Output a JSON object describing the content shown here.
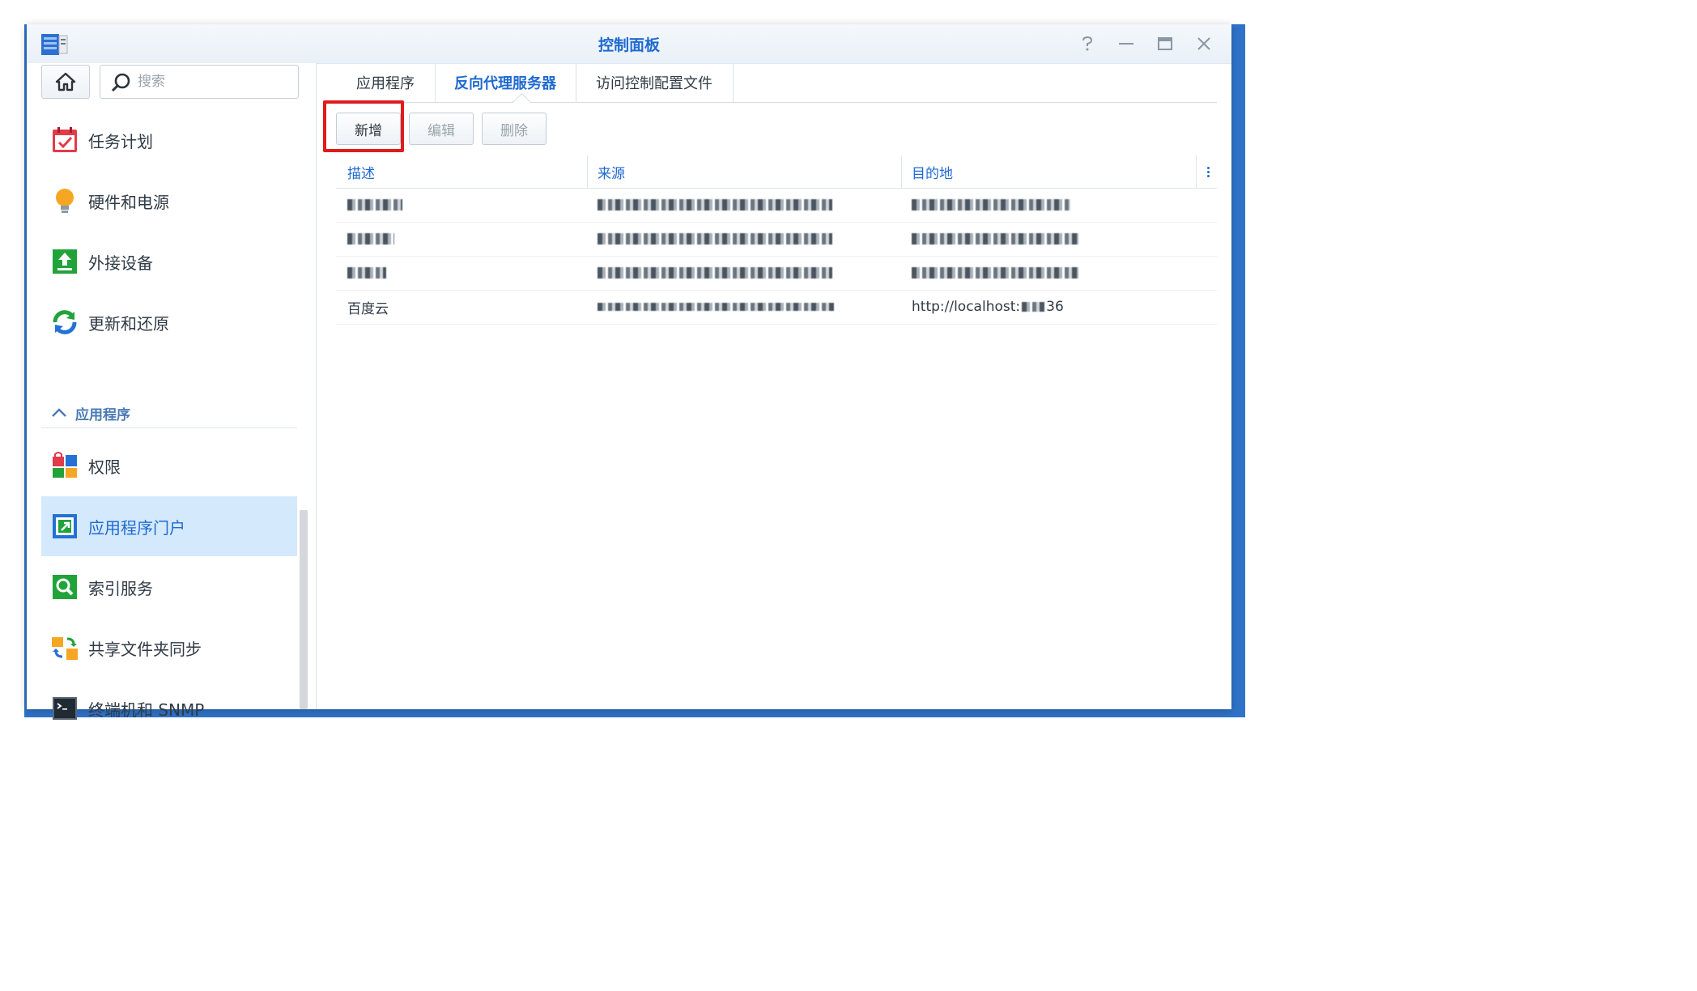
{
  "window": {
    "title": "控制面板"
  },
  "window_controls": {
    "help": "?",
    "minimize": "—",
    "maximize": "☐",
    "close": "✕"
  },
  "sidebar": {
    "search_placeholder": "搜索",
    "items_top": [
      {
        "label": "任务计划",
        "icon": "calendar-check-icon"
      },
      {
        "label": "硬件和电源",
        "icon": "lightbulb-icon"
      },
      {
        "label": "外接设备",
        "icon": "external-device-icon"
      },
      {
        "label": "更新和还原",
        "icon": "update-restore-icon"
      }
    ],
    "section_label": "应用程序",
    "items_apps": [
      {
        "label": "权限",
        "icon": "privileges-icon"
      },
      {
        "label": "应用程序门户",
        "icon": "app-portal-icon",
        "active": true
      },
      {
        "label": "索引服务",
        "icon": "indexing-icon"
      },
      {
        "label": "共享文件夹同步",
        "icon": "folder-sync-icon"
      },
      {
        "label": "终端机和 SNMP",
        "icon": "terminal-icon"
      }
    ]
  },
  "tabs": [
    {
      "label": "应用程序"
    },
    {
      "label": "反向代理服务器",
      "active": true
    },
    {
      "label": "访问控制配置文件"
    }
  ],
  "toolbar": {
    "create": "新增",
    "edit": "编辑",
    "delete": "删除"
  },
  "grid": {
    "columns": [
      "描述",
      "来源",
      "目的地"
    ],
    "rows": [
      {
        "description": "",
        "source": "",
        "destination": ""
      },
      {
        "description": "",
        "source": "",
        "destination": ""
      },
      {
        "description": "",
        "source": "",
        "destination": ""
      },
      {
        "description": "百度云",
        "source": "",
        "destination_prefix": "http://localhost:",
        "destination_suffix": "36"
      }
    ]
  },
  "colors": {
    "accent": "#1f6ad0",
    "active_bg": "#d4e9fb",
    "highlight": "#e01b1b",
    "desktop": "#2f73c9"
  }
}
